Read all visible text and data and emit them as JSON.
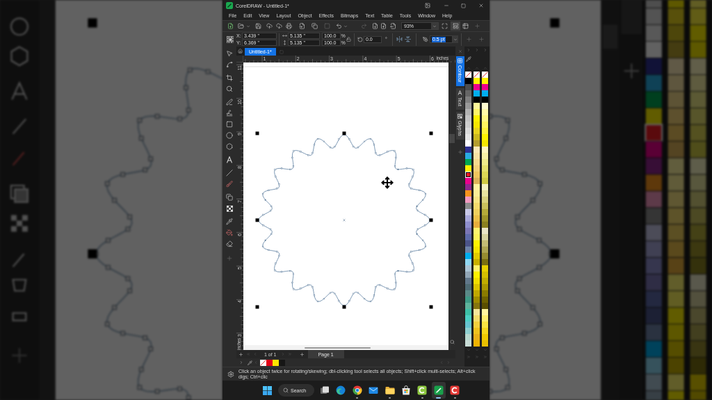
{
  "window": {
    "title": "CorelDRAW - Untitled-1*"
  },
  "menu": [
    "File",
    "Edit",
    "View",
    "Layout",
    "Object",
    "Effects",
    "Bitmaps",
    "Text",
    "Table",
    "Tools",
    "Window",
    "Help"
  ],
  "toolbar": {
    "zoom": "93%"
  },
  "property_bar": {
    "position": [
      {
        "label": "X:",
        "value": "3.439 \""
      },
      {
        "label": "Y:",
        "value": "6.369 \""
      }
    ],
    "size": [
      {
        "value": "5.135 \""
      },
      {
        "value": "5.135 \""
      }
    ],
    "scale": [
      {
        "value": "100.0",
        "unit": "%"
      },
      {
        "value": "100.0",
        "unit": "%"
      }
    ],
    "rotation": {
      "value": "0.0",
      "unit": "°"
    },
    "outline_width": {
      "value": "0.5 pt",
      "selected": true
    }
  },
  "document_tabs": [
    {
      "label": "Untitled-1*",
      "selected": true
    }
  ],
  "rulers": {
    "top": {
      "labels": [
        "1",
        "2",
        "3",
        "4",
        "5",
        "6"
      ],
      "unit": "inches"
    },
    "left": {
      "labels": [
        "11",
        "10",
        "9",
        "8",
        "7",
        "6",
        "5",
        "4",
        "3"
      ],
      "unit": "inches"
    }
  },
  "dockers": [
    {
      "label": "Contour",
      "selected": true
    },
    {
      "label": "Text",
      "selected": false
    },
    {
      "label": "Glyphs",
      "selected": false
    }
  ],
  "color_palette": {
    "columns": [
      {
        "none_swatch": true,
        "swatches": [
          {
            "color": "#000000",
            "selected": false
          },
          {
            "color": "#4d4d4d",
            "selected": false
          },
          {
            "color": "#666666",
            "selected": false
          },
          {
            "color": "#808080",
            "selected": false
          },
          {
            "color": "#999999",
            "selected": false
          },
          {
            "color": "#b3b3b3",
            "selected": false
          },
          {
            "color": "#c4c4c4",
            "selected": false
          },
          {
            "color": "#cccccc",
            "selected": false
          },
          {
            "color": "#dadada",
            "selected": false
          },
          {
            "color": "#e6e6e6",
            "selected": false
          },
          {
            "color": "#ffffff",
            "selected": false
          },
          {
            "color": "#2e3192",
            "selected": false
          },
          {
            "color": "#29abe2",
            "selected": false
          },
          {
            "color": "#00a651",
            "selected": false
          },
          {
            "color": "#fff200",
            "selected": false
          },
          {
            "color": "#ed1c24",
            "selected": true
          },
          {
            "color": "#ec008c",
            "selected": false
          },
          {
            "color": "#92278f",
            "selected": false
          },
          {
            "color": "#f7941d",
            "selected": false
          },
          {
            "color": "#f49ac1",
            "selected": false
          },
          {
            "color": "#8c8c8c",
            "selected": false
          },
          {
            "color": "#c9c9e8",
            "selected": false
          },
          {
            "color": "#a9a9db",
            "selected": false
          },
          {
            "color": "#8e8ecd",
            "selected": false
          },
          {
            "color": "#7b76b5",
            "selected": false
          },
          {
            "color": "#5e6ba9",
            "selected": false
          },
          {
            "color": "#4b5489",
            "selected": false
          },
          {
            "color": "#6e83a8",
            "selected": false
          },
          {
            "color": "#00aeef",
            "selected": false
          },
          {
            "color": "#8fd7f2",
            "selected": false
          },
          {
            "color": "#aac4d5",
            "selected": false
          },
          {
            "color": "#91a5b5",
            "selected": false
          },
          {
            "color": "#61778a",
            "selected": false
          },
          {
            "color": "#4f6b74",
            "selected": false
          },
          {
            "color": "#5a8a88",
            "selected": false
          },
          {
            "color": "#3f9a86",
            "selected": false
          },
          {
            "color": "#5db39c",
            "selected": false
          },
          {
            "color": "#3dbfa6",
            "selected": false
          },
          {
            "color": "#4ccfc3",
            "selected": false
          },
          {
            "color": "#66c3cf",
            "selected": false
          },
          {
            "color": "#8ecfd0",
            "selected": false
          },
          {
            "color": "#b8d8cf",
            "selected": false
          },
          {
            "color": "#c8dcd6",
            "selected": false
          }
        ]
      },
      {
        "none_swatch": true,
        "swatches": [
          {
            "color": "#fff200",
            "selected": false
          },
          {
            "color": "#ec008c",
            "selected": false
          },
          {
            "color": "#00aeef",
            "selected": false
          },
          {
            "color": "#000000",
            "selected": false
          },
          {
            "color": "#fff799",
            "selected": false
          },
          {
            "color": "#fff568",
            "selected": false
          },
          {
            "color": "#fff200",
            "selected": false
          },
          {
            "color": "#f7e600",
            "selected": false
          },
          {
            "color": "#e6d21e",
            "selected": false
          },
          {
            "color": "#cbb81e",
            "selected": false
          },
          {
            "color": "#b39d2e",
            "selected": false
          },
          {
            "color": "#fbe9b7",
            "selected": false
          },
          {
            "color": "#f7e2a4",
            "selected": false
          },
          {
            "color": "#f5da8d",
            "selected": false
          },
          {
            "color": "#f3d178",
            "selected": false
          },
          {
            "color": "#efc65e",
            "selected": false
          },
          {
            "color": "#dcb35a",
            "selected": false
          },
          {
            "color": "#fff3a0",
            "selected": false
          },
          {
            "color": "#fdee96",
            "selected": false
          },
          {
            "color": "#f9e584",
            "selected": false
          },
          {
            "color": "#f5da6c",
            "selected": false
          },
          {
            "color": "#f0cf5e",
            "selected": false
          },
          {
            "color": "#ecc04a",
            "selected": false
          },
          {
            "color": "#e7ae3c",
            "selected": false
          },
          {
            "color": "#fff56e",
            "selected": false
          },
          {
            "color": "#fff35c",
            "selected": false
          },
          {
            "color": "#fff200",
            "selected": false
          },
          {
            "color": "#f5e400",
            "selected": false
          },
          {
            "color": "#e0cb00",
            "selected": false
          },
          {
            "color": "#c8b100",
            "selected": false
          },
          {
            "color": "#fff46d",
            "selected": false
          },
          {
            "color": "#fff200",
            "selected": false
          },
          {
            "color": "#f2de00",
            "selected": false
          },
          {
            "color": "#dcc400",
            "selected": false
          },
          {
            "color": "#c0a800",
            "selected": false
          },
          {
            "color": "#a08c00",
            "selected": false
          },
          {
            "color": "#86750f",
            "selected": false
          },
          {
            "color": "#f8e79b",
            "selected": false
          },
          {
            "color": "#f5dd6a",
            "selected": false
          },
          {
            "color": "#f2d03e",
            "selected": false
          },
          {
            "color": "#eec21e",
            "selected": false
          },
          {
            "color": "#e8b11a",
            "selected": false
          },
          {
            "color": "#f0b400",
            "selected": false
          }
        ]
      },
      {
        "none_swatch": true,
        "swatches": [
          {
            "color": "#fff200",
            "selected": false
          },
          {
            "color": "#ec008c",
            "selected": false
          },
          {
            "color": "#00aeef",
            "selected": false
          },
          {
            "color": "#000000",
            "selected": false
          },
          {
            "color": "#fffbcf",
            "selected": false
          },
          {
            "color": "#fff9a8",
            "selected": false
          },
          {
            "color": "#fff685",
            "selected": false
          },
          {
            "color": "#fff460",
            "selected": false
          },
          {
            "color": "#fff23a",
            "selected": false
          },
          {
            "color": "#fff200",
            "selected": false
          },
          {
            "color": "#f3e600",
            "selected": false
          },
          {
            "color": "#fff6c0",
            "selected": false
          },
          {
            "color": "#f7f0a5",
            "selected": false
          },
          {
            "color": "#eeea8a",
            "selected": false
          },
          {
            "color": "#e5e06e",
            "selected": false
          },
          {
            "color": "#dcd655",
            "selected": false
          },
          {
            "color": "#d0ca45",
            "selected": false
          },
          {
            "color": "#f6f3c2",
            "selected": false
          },
          {
            "color": "#e8e4a0",
            "selected": false
          },
          {
            "color": "#d8d27e",
            "selected": false
          },
          {
            "color": "#c8c05c",
            "selected": false
          },
          {
            "color": "#b4aa3a",
            "selected": false
          },
          {
            "color": "#9e942a",
            "selected": false
          },
          {
            "color": "#8a8020",
            "selected": false
          },
          {
            "color": "#ebe6c8",
            "selected": false
          },
          {
            "color": "#d8d3a0",
            "selected": false
          },
          {
            "color": "#c3bc75",
            "selected": false
          },
          {
            "color": "#aea552",
            "selected": false
          },
          {
            "color": "#978c30",
            "selected": false
          },
          {
            "color": "#7a6f10",
            "selected": false
          },
          {
            "color": "#e6d000",
            "selected": false
          },
          {
            "color": "#d4bf00",
            "selected": false
          },
          {
            "color": "#c0ad00",
            "selected": false
          },
          {
            "color": "#a99700",
            "selected": false
          },
          {
            "color": "#8a7b00",
            "selected": false
          },
          {
            "color": "#6e6100",
            "selected": false
          },
          {
            "color": "#5a4e00",
            "selected": false
          },
          {
            "color": "#fff5a0",
            "selected": false
          },
          {
            "color": "#fdee70",
            "selected": false
          },
          {
            "color": "#f9e443",
            "selected": false
          },
          {
            "color": "#f5d81c",
            "selected": false
          },
          {
            "color": "#efca00",
            "selected": false
          },
          {
            "color": "#e8c000",
            "selected": false
          }
        ]
      }
    ]
  },
  "page_navigator": {
    "counter": "1 of 1",
    "pages": [
      {
        "label": "Page 1",
        "selected": true
      }
    ]
  },
  "document_palette": {
    "none_swatch": true,
    "swatches": [
      {
        "color": "#e30016"
      },
      {
        "color": "#ffe600"
      },
      {
        "color": "#161616"
      }
    ]
  },
  "status_bar": {
    "text": "Click an object twice for rotating/skewing; dbl-clicking tool selects all objects; Shift+click multi-selects; Alt+click digs; Ctrl+clic"
  },
  "taskbar": {
    "search": {
      "label": "Search"
    },
    "apps": [
      {
        "kind": "taskview",
        "running": false,
        "active": false
      },
      {
        "kind": "edge",
        "running": false,
        "active": false
      },
      {
        "kind": "chrome",
        "running": true,
        "active": false
      },
      {
        "kind": "mail",
        "running": false,
        "active": false
      },
      {
        "kind": "folder",
        "running": true,
        "active": false
      },
      {
        "kind": "store",
        "running": false,
        "active": false
      },
      {
        "kind": "greenc",
        "running": true,
        "active": false
      },
      {
        "kind": "greenpen",
        "running": true,
        "active": true
      },
      {
        "kind": "redc",
        "running": true,
        "active": false
      }
    ]
  }
}
